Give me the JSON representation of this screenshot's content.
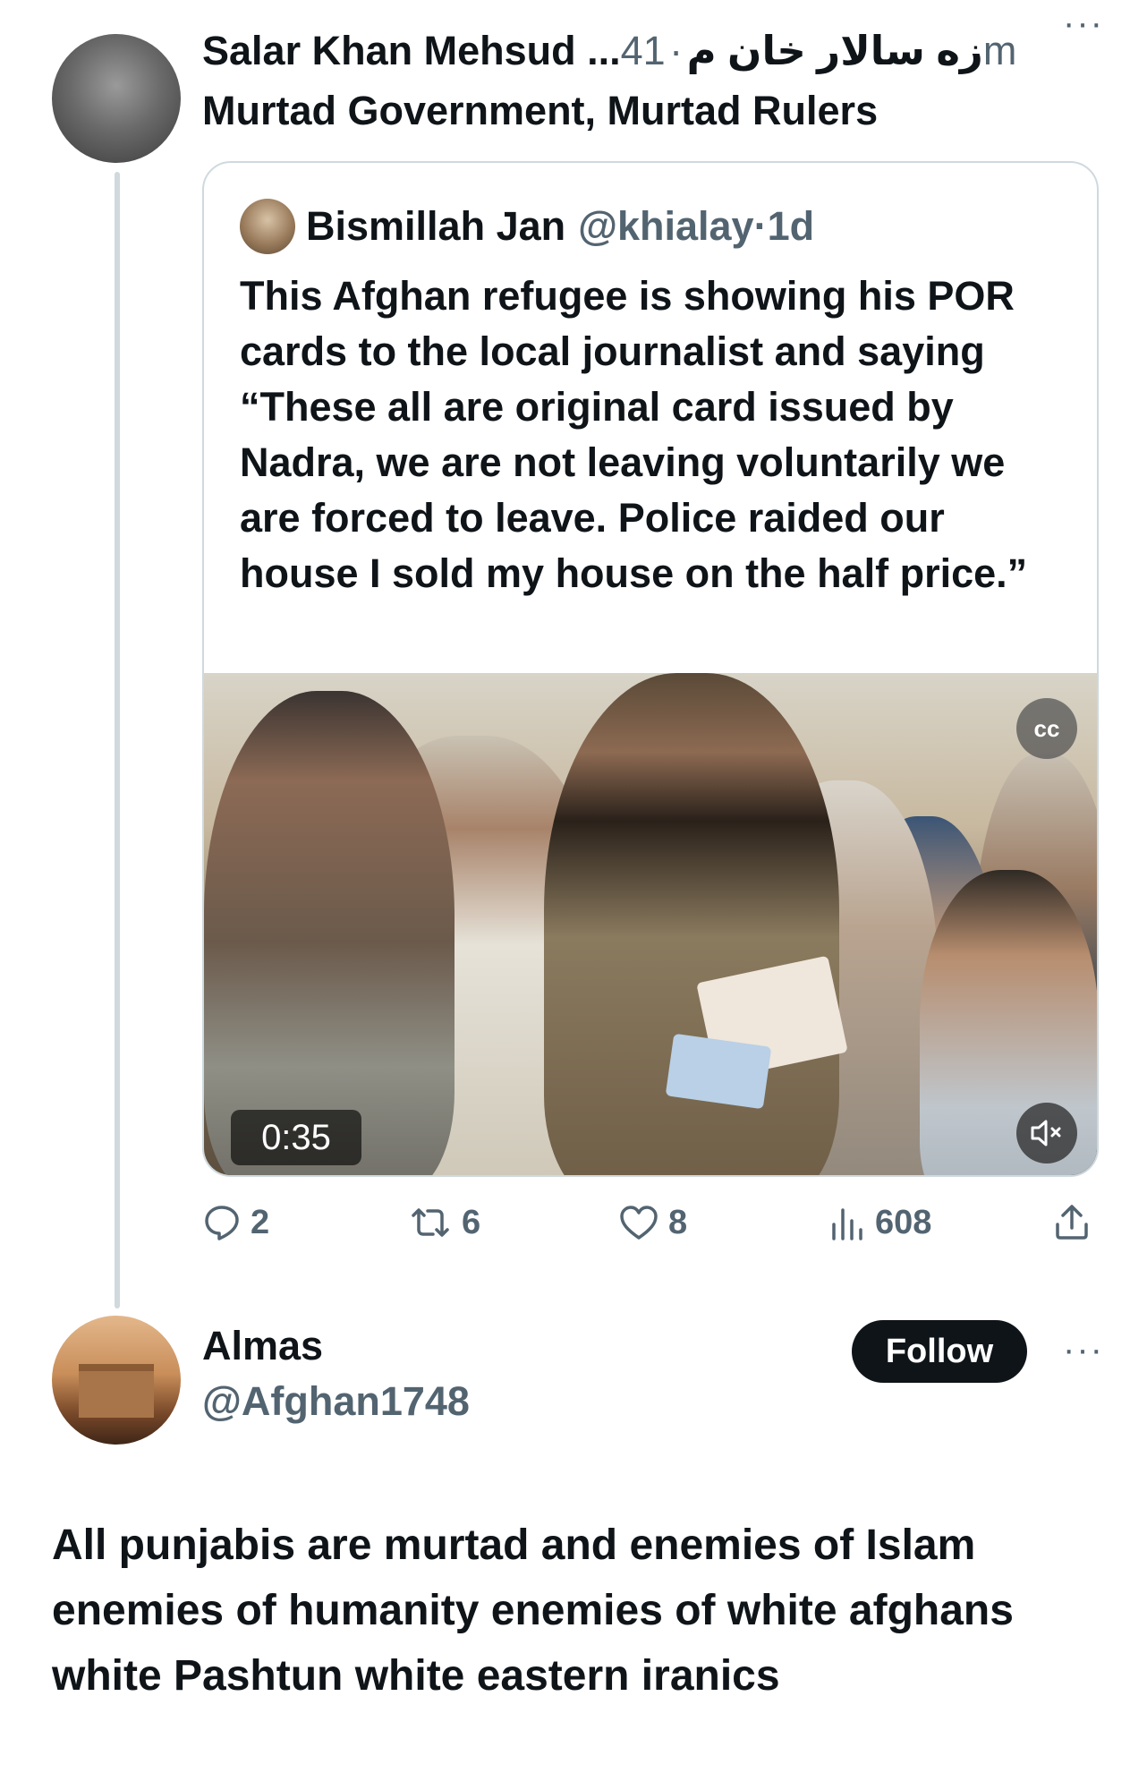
{
  "tweet": {
    "author_name": "Salar Khan Mehsud ...زه سالار خان م",
    "separator": "·",
    "time": "41m",
    "more": "···",
    "text": "Murtad Government, Murtad Rulers",
    "quoted": {
      "author_name": "Bismillah Jan",
      "handle": "@khialay",
      "separator": "·",
      "time": "1d",
      "text": "This Afghan refugee is showing his POR cards to the local journalist and saying “These all are original card issued by Nadra, we are not leaving voluntarily we are forced to leave. Police raided our house I sold my house on the half price.”",
      "video": {
        "duration": "0:35",
        "cc_label": "cc"
      }
    },
    "actions": {
      "replies": "2",
      "retweets": "6",
      "likes": "8",
      "views": "608"
    }
  },
  "reply": {
    "author_name": "Almas",
    "handle": "@Afghan1748",
    "follow_label": "Follow",
    "more": "···",
    "text": "All punjabis are murtad and enemies of Islam enemies of humanity enemies of white afghans white Pashtun white eastern iranics"
  },
  "colors": {
    "text": "#0f1419",
    "secondary": "#536471",
    "border": "#cfd9de",
    "follow_bg": "#0f1419"
  }
}
